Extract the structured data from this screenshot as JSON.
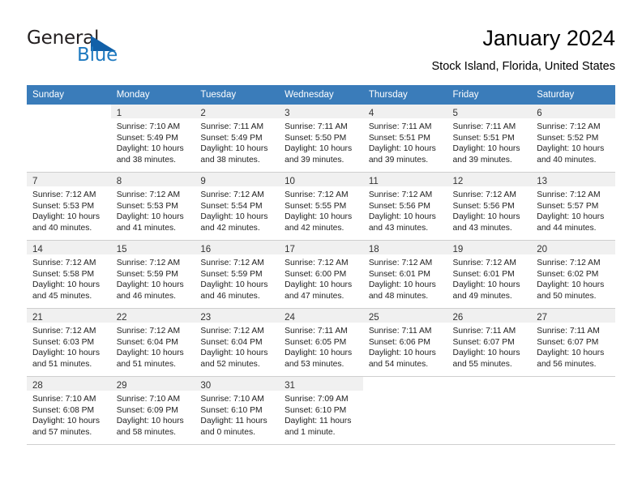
{
  "brand": {
    "name_part1": "General",
    "name_part2": "Blue",
    "accent_color": "#1f7ac0",
    "triangle_color": "#1160a8"
  },
  "header": {
    "title": "January 2024",
    "subtitle": "Stock Island, Florida, United States"
  },
  "theme": {
    "header_bg": "#3a7cba",
    "daynum_bg": "#f0f0f0",
    "grid_line": "#cfcfcf"
  },
  "weekday_headers": [
    "Sunday",
    "Monday",
    "Tuesday",
    "Wednesday",
    "Thursday",
    "Friday",
    "Saturday"
  ],
  "weeks": [
    [
      {
        "day": "",
        "lines": []
      },
      {
        "day": "1",
        "lines": [
          "Sunrise: 7:10 AM",
          "Sunset: 5:49 PM",
          "Daylight: 10 hours",
          "and 38 minutes."
        ]
      },
      {
        "day": "2",
        "lines": [
          "Sunrise: 7:11 AM",
          "Sunset: 5:49 PM",
          "Daylight: 10 hours",
          "and 38 minutes."
        ]
      },
      {
        "day": "3",
        "lines": [
          "Sunrise: 7:11 AM",
          "Sunset: 5:50 PM",
          "Daylight: 10 hours",
          "and 39 minutes."
        ]
      },
      {
        "day": "4",
        "lines": [
          "Sunrise: 7:11 AM",
          "Sunset: 5:51 PM",
          "Daylight: 10 hours",
          "and 39 minutes."
        ]
      },
      {
        "day": "5",
        "lines": [
          "Sunrise: 7:11 AM",
          "Sunset: 5:51 PM",
          "Daylight: 10 hours",
          "and 39 minutes."
        ]
      },
      {
        "day": "6",
        "lines": [
          "Sunrise: 7:12 AM",
          "Sunset: 5:52 PM",
          "Daylight: 10 hours",
          "and 40 minutes."
        ]
      }
    ],
    [
      {
        "day": "7",
        "lines": [
          "Sunrise: 7:12 AM",
          "Sunset: 5:53 PM",
          "Daylight: 10 hours",
          "and 40 minutes."
        ]
      },
      {
        "day": "8",
        "lines": [
          "Sunrise: 7:12 AM",
          "Sunset: 5:53 PM",
          "Daylight: 10 hours",
          "and 41 minutes."
        ]
      },
      {
        "day": "9",
        "lines": [
          "Sunrise: 7:12 AM",
          "Sunset: 5:54 PM",
          "Daylight: 10 hours",
          "and 42 minutes."
        ]
      },
      {
        "day": "10",
        "lines": [
          "Sunrise: 7:12 AM",
          "Sunset: 5:55 PM",
          "Daylight: 10 hours",
          "and 42 minutes."
        ]
      },
      {
        "day": "11",
        "lines": [
          "Sunrise: 7:12 AM",
          "Sunset: 5:56 PM",
          "Daylight: 10 hours",
          "and 43 minutes."
        ]
      },
      {
        "day": "12",
        "lines": [
          "Sunrise: 7:12 AM",
          "Sunset: 5:56 PM",
          "Daylight: 10 hours",
          "and 43 minutes."
        ]
      },
      {
        "day": "13",
        "lines": [
          "Sunrise: 7:12 AM",
          "Sunset: 5:57 PM",
          "Daylight: 10 hours",
          "and 44 minutes."
        ]
      }
    ],
    [
      {
        "day": "14",
        "lines": [
          "Sunrise: 7:12 AM",
          "Sunset: 5:58 PM",
          "Daylight: 10 hours",
          "and 45 minutes."
        ]
      },
      {
        "day": "15",
        "lines": [
          "Sunrise: 7:12 AM",
          "Sunset: 5:59 PM",
          "Daylight: 10 hours",
          "and 46 minutes."
        ]
      },
      {
        "day": "16",
        "lines": [
          "Sunrise: 7:12 AM",
          "Sunset: 5:59 PM",
          "Daylight: 10 hours",
          "and 46 minutes."
        ]
      },
      {
        "day": "17",
        "lines": [
          "Sunrise: 7:12 AM",
          "Sunset: 6:00 PM",
          "Daylight: 10 hours",
          "and 47 minutes."
        ]
      },
      {
        "day": "18",
        "lines": [
          "Sunrise: 7:12 AM",
          "Sunset: 6:01 PM",
          "Daylight: 10 hours",
          "and 48 minutes."
        ]
      },
      {
        "day": "19",
        "lines": [
          "Sunrise: 7:12 AM",
          "Sunset: 6:01 PM",
          "Daylight: 10 hours",
          "and 49 minutes."
        ]
      },
      {
        "day": "20",
        "lines": [
          "Sunrise: 7:12 AM",
          "Sunset: 6:02 PM",
          "Daylight: 10 hours",
          "and 50 minutes."
        ]
      }
    ],
    [
      {
        "day": "21",
        "lines": [
          "Sunrise: 7:12 AM",
          "Sunset: 6:03 PM",
          "Daylight: 10 hours",
          "and 51 minutes."
        ]
      },
      {
        "day": "22",
        "lines": [
          "Sunrise: 7:12 AM",
          "Sunset: 6:04 PM",
          "Daylight: 10 hours",
          "and 51 minutes."
        ]
      },
      {
        "day": "23",
        "lines": [
          "Sunrise: 7:12 AM",
          "Sunset: 6:04 PM",
          "Daylight: 10 hours",
          "and 52 minutes."
        ]
      },
      {
        "day": "24",
        "lines": [
          "Sunrise: 7:11 AM",
          "Sunset: 6:05 PM",
          "Daylight: 10 hours",
          "and 53 minutes."
        ]
      },
      {
        "day": "25",
        "lines": [
          "Sunrise: 7:11 AM",
          "Sunset: 6:06 PM",
          "Daylight: 10 hours",
          "and 54 minutes."
        ]
      },
      {
        "day": "26",
        "lines": [
          "Sunrise: 7:11 AM",
          "Sunset: 6:07 PM",
          "Daylight: 10 hours",
          "and 55 minutes."
        ]
      },
      {
        "day": "27",
        "lines": [
          "Sunrise: 7:11 AM",
          "Sunset: 6:07 PM",
          "Daylight: 10 hours",
          "and 56 minutes."
        ]
      }
    ],
    [
      {
        "day": "28",
        "lines": [
          "Sunrise: 7:10 AM",
          "Sunset: 6:08 PM",
          "Daylight: 10 hours",
          "and 57 minutes."
        ]
      },
      {
        "day": "29",
        "lines": [
          "Sunrise: 7:10 AM",
          "Sunset: 6:09 PM",
          "Daylight: 10 hours",
          "and 58 minutes."
        ]
      },
      {
        "day": "30",
        "lines": [
          "Sunrise: 7:10 AM",
          "Sunset: 6:10 PM",
          "Daylight: 11 hours",
          "and 0 minutes."
        ]
      },
      {
        "day": "31",
        "lines": [
          "Sunrise: 7:09 AM",
          "Sunset: 6:10 PM",
          "Daylight: 11 hours",
          "and 1 minute."
        ]
      },
      {
        "day": "",
        "lines": []
      },
      {
        "day": "",
        "lines": []
      },
      {
        "day": "",
        "lines": []
      }
    ]
  ]
}
